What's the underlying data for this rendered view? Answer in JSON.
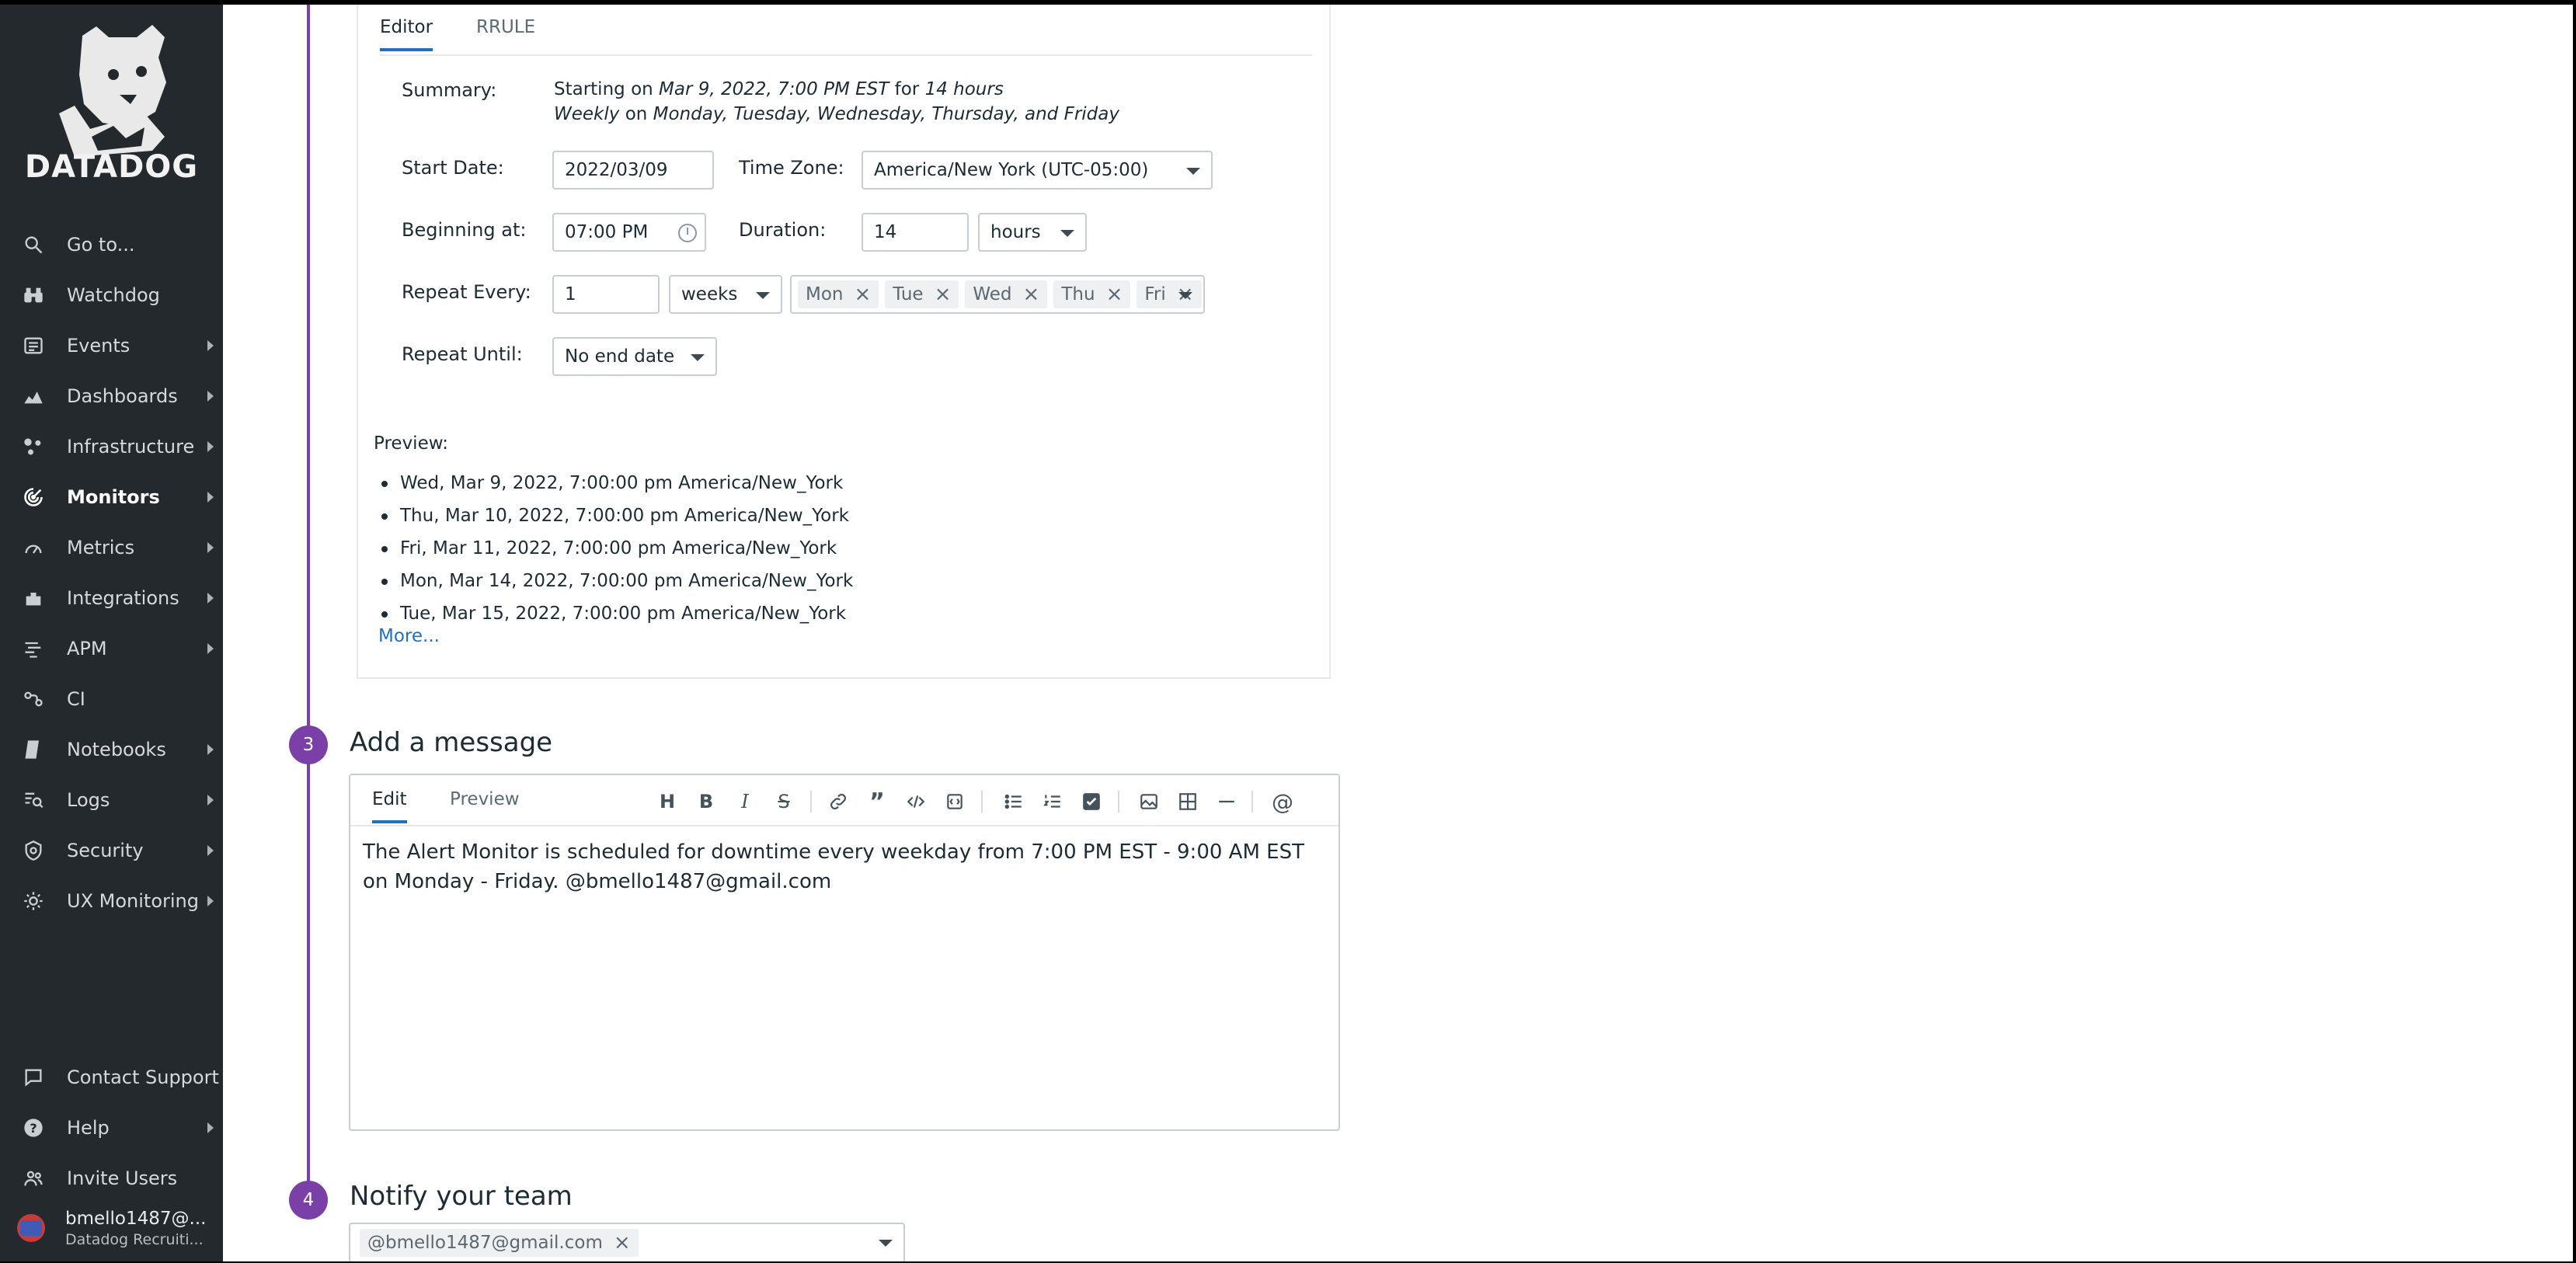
{
  "sidebar": {
    "logo_text": "DATADOG",
    "items": [
      {
        "label": "Go to...",
        "icon": "search-icon",
        "chevron": false,
        "active": false
      },
      {
        "label": "Watchdog",
        "icon": "binoculars-icon",
        "chevron": false,
        "active": false
      },
      {
        "label": "Events",
        "icon": "events-icon",
        "chevron": true,
        "active": false
      },
      {
        "label": "Dashboards",
        "icon": "dashboards-icon",
        "chevron": true,
        "active": false
      },
      {
        "label": "Infrastructure",
        "icon": "infrastructure-icon",
        "chevron": true,
        "active": false
      },
      {
        "label": "Monitors",
        "icon": "monitors-icon",
        "chevron": true,
        "active": true
      },
      {
        "label": "Metrics",
        "icon": "metrics-icon",
        "chevron": true,
        "active": false
      },
      {
        "label": "Integrations",
        "icon": "integrations-icon",
        "chevron": true,
        "active": false
      },
      {
        "label": "APM",
        "icon": "apm-icon",
        "chevron": true,
        "active": false
      },
      {
        "label": "CI",
        "icon": "ci-icon",
        "chevron": false,
        "active": false
      },
      {
        "label": "Notebooks",
        "icon": "notebook-icon",
        "chevron": true,
        "active": false
      },
      {
        "label": "Logs",
        "icon": "logs-icon",
        "chevron": true,
        "active": false
      },
      {
        "label": "Security",
        "icon": "shield-icon",
        "chevron": true,
        "active": false
      },
      {
        "label": "UX Monitoring",
        "icon": "ux-monitoring-icon",
        "chevron": true,
        "active": false
      }
    ],
    "bottom_items": [
      {
        "label": "Contact Support",
        "icon": "chat-icon",
        "chevron": false
      },
      {
        "label": "Help",
        "icon": "help-icon",
        "chevron": true
      },
      {
        "label": "Invite Users",
        "icon": "users-icon",
        "chevron": false
      }
    ],
    "user": {
      "name": "bmello1487@...",
      "org": "Datadog Recruiti..."
    }
  },
  "schedule": {
    "tabs": [
      "Editor",
      "RRULE"
    ],
    "summary_label": "Summary:",
    "summary": {
      "starting_on": "Starting on",
      "start": "Mar 9, 2022, 7:00 PM EST",
      "for": "for",
      "duration": "14 hours",
      "weekly": "Weekly",
      "on": "on",
      "days": "Monday, Tuesday, Wednesday, Thursday, and Friday"
    },
    "start_date_label": "Start Date:",
    "start_date": "2022/03/09",
    "time_zone_label": "Time Zone:",
    "time_zone": "America/New York (UTC-05:00)",
    "beginning_label": "Beginning at:",
    "beginning": "07:00  PM",
    "duration_label": "Duration:",
    "duration_value": "14",
    "duration_unit": "hours",
    "repeat_every_label": "Repeat Every:",
    "repeat_every_value": "1",
    "repeat_every_unit": "weeks",
    "weekdays": [
      "Mon",
      "Tue",
      "Wed",
      "Thu",
      "Fri"
    ],
    "repeat_until_label": "Repeat Until:",
    "repeat_until": "No end date",
    "preview_label": "Preview:",
    "preview": [
      "Wed, Mar 9, 2022, 7:00:00 pm America/New_York",
      "Thu, Mar 10, 2022, 7:00:00 pm America/New_York",
      "Fri, Mar 11, 2022, 7:00:00 pm America/New_York",
      "Mon, Mar 14, 2022, 7:00:00 pm America/New_York",
      "Tue, Mar 15, 2022, 7:00:00 pm America/New_York"
    ],
    "more": "More..."
  },
  "message": {
    "step": "3",
    "title": "Add a message",
    "tabs": [
      "Edit",
      "Preview"
    ],
    "body": "The Alert Monitor is scheduled for downtime every weekday from 7:00 PM EST - 9:00 AM EST on Monday - Friday. @bmello1487@gmail.com"
  },
  "notify": {
    "step": "4",
    "title": "Notify your team",
    "recipient": "@bmello1487@gmail.com"
  },
  "colors": {
    "accent": "#7b3fa8",
    "link": "#1f70c1",
    "sidebar": "#24292e"
  }
}
